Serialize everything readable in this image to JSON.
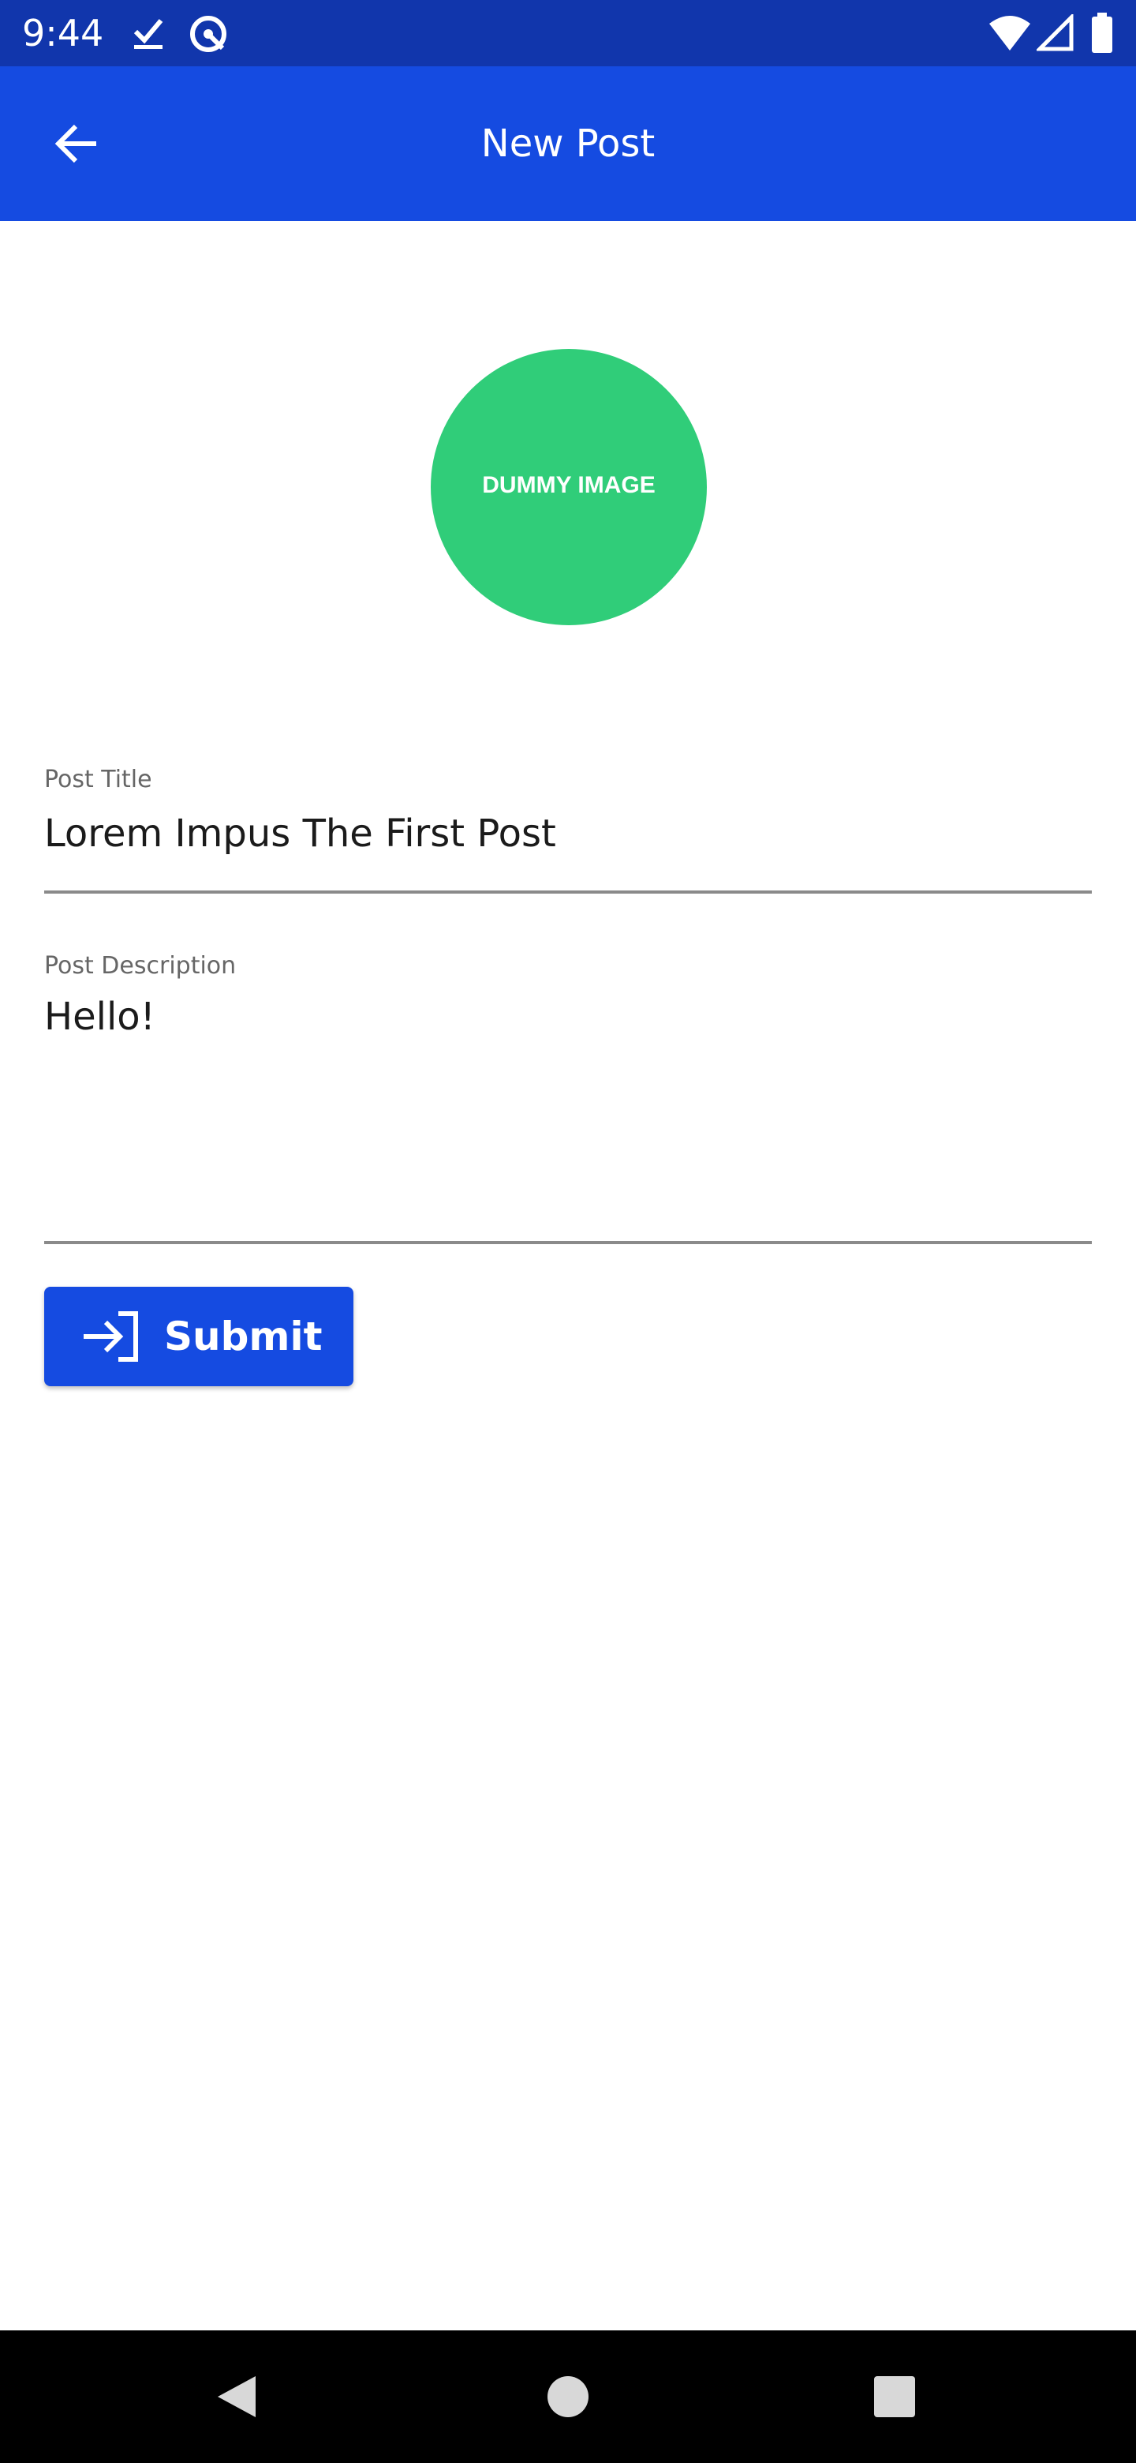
{
  "status_bar": {
    "time": "9:44",
    "icons": [
      "checkmark-icon",
      "assistant-icon",
      "wifi-icon",
      "cellular-signal-icon",
      "battery-icon"
    ]
  },
  "app_bar": {
    "title": "New Post",
    "back_icon": "arrow-left-icon"
  },
  "image": {
    "placeholder_text": "DUMMY IMAGE",
    "color": "#30cd79"
  },
  "form": {
    "title_field": {
      "label": "Post Title",
      "value": "Lorem Impus The First Post"
    },
    "description_field": {
      "label": "Post Description",
      "value": "Hello!"
    },
    "submit": {
      "label": "Submit",
      "icon": "login-arrow-icon"
    }
  },
  "navigation_bar": {
    "buttons": [
      "back-triangle-icon",
      "home-circle-icon",
      "recents-square-icon"
    ]
  },
  "colors": {
    "status_bar": "#1136ac",
    "primary": "#154be1",
    "accent_image": "#30cd79",
    "underline": "#8a8a8a"
  }
}
